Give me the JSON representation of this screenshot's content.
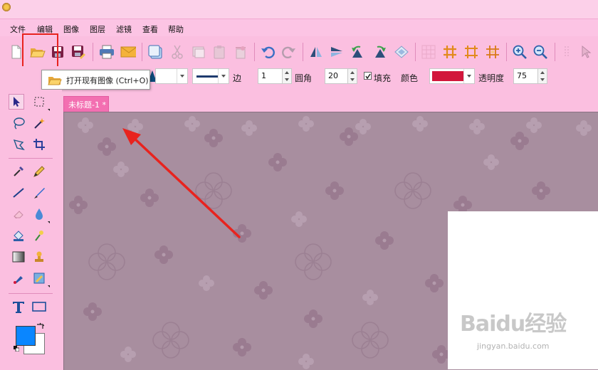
{
  "menu": [
    {
      "id": "file",
      "label": "文件"
    },
    {
      "id": "edit",
      "label": "编辑"
    },
    {
      "id": "image",
      "label": "图像"
    },
    {
      "id": "layer",
      "label": "图层"
    },
    {
      "id": "filter",
      "label": "滤镜"
    },
    {
      "id": "view",
      "label": "查看"
    },
    {
      "id": "help",
      "label": "帮助"
    }
  ],
  "tooltip": {
    "text": "打开现有图像 (Ctrl+O)"
  },
  "propbar": {
    "border_label": "边",
    "border_value": "1",
    "corner_label": "圆角",
    "corner_value": "20",
    "fill_label": "填充",
    "fill_checked": true,
    "color_label": "颜色",
    "fill_color": "#d2173c",
    "opacity_label": "透明度",
    "opacity_value": "75"
  },
  "document": {
    "tab_label": "未标题-1 *"
  },
  "colors": {
    "foreground": "#0a86ff",
    "background": "#ffffff",
    "accent_highlight": "#e8231e"
  },
  "watermark": {
    "main": "Baidu经验",
    "sub": "jingyan.baidu.com"
  }
}
